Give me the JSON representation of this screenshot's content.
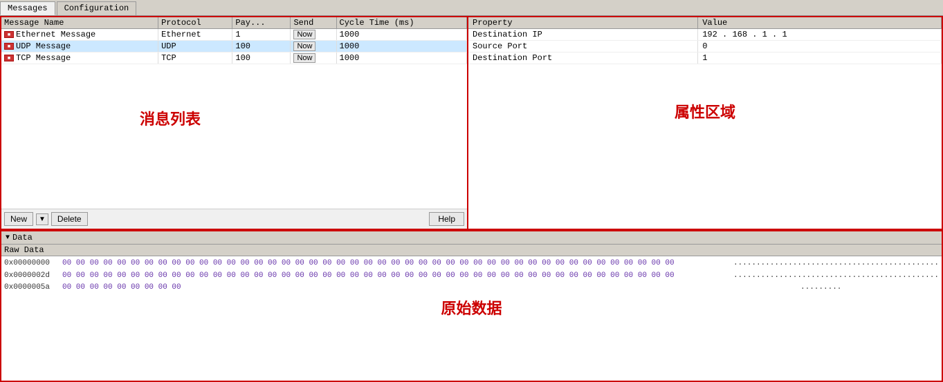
{
  "tabs": [
    {
      "label": "Messages",
      "active": true
    },
    {
      "label": "Configuration",
      "active": false
    }
  ],
  "messageTable": {
    "headers": [
      "Message Name",
      "Protocol",
      "Pay...",
      "Send",
      "Cycle Time (ms)"
    ],
    "rows": [
      {
        "icon": "■",
        "name": "Ethernet Message",
        "protocol": "Ethernet",
        "payload": "1",
        "send": "Now",
        "cycleTime": "1000",
        "selected": false
      },
      {
        "icon": "■",
        "name": "UDP Message",
        "protocol": "UDP",
        "payload": "100",
        "send": "Now",
        "cycleTime": "1000",
        "selected": true
      },
      {
        "icon": "■",
        "name": "TCP Message",
        "protocol": "TCP",
        "payload": "100",
        "send": "Now",
        "cycleTime": "1000",
        "selected": false
      }
    ]
  },
  "toolbar": {
    "newLabel": "New",
    "deleteLabel": "Delete",
    "helpLabel": "Help"
  },
  "watermarks": {
    "messageList": "消息列表",
    "propertyArea": "属性区域",
    "rawData": "原始数据"
  },
  "propertyTable": {
    "headers": [
      "Property",
      "Value"
    ],
    "rows": [
      {
        "property": "Destination IP",
        "value": "192 . 168 . 1 . 1"
      },
      {
        "property": "Source Port",
        "value": "0"
      },
      {
        "property": "Destination Port",
        "value": "1"
      }
    ]
  },
  "dataSection": {
    "headerLabel": "Data",
    "rawDataLabel": "Raw Data",
    "hexLines": [
      {
        "addr": "0x00000000",
        "bytes": "00 00 00 00 00 00 00 00 00 00 00 00 00 00 00 00 00 00 00 00 00 00 00 00 00 00 00 00 00 00 00 00 00 00 00 00 00 00 00 00 00 00 00 00 00",
        "ascii": "............................................."
      },
      {
        "addr": "0x0000002d",
        "bytes": "00 00 00 00 00 00 00 00 00 00 00 00 00 00 00 00 00 00 00 00 00 00 00 00 00 00 00 00 00 00 00 00 00 00 00 00 00 00 00 00 00 00 00 00 00",
        "ascii": "............................................."
      },
      {
        "addr": "0x0000005a",
        "bytes": "00 00 00 00 00 00 00 00 00",
        "ascii": "........."
      }
    ]
  }
}
